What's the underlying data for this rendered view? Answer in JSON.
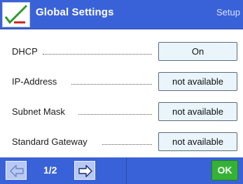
{
  "header": {
    "title": "Global Settings",
    "context": "Setup",
    "icon": "checkmark-settings-icon"
  },
  "settings": [
    {
      "label": "DHCP",
      "value": "On"
    },
    {
      "label": "IP-Address",
      "value": "not available"
    },
    {
      "label": "Subnet Mask",
      "value": "not available"
    },
    {
      "label": "Standard Gateway",
      "value": "not available"
    }
  ],
  "footer": {
    "page_indicator": "1/2",
    "prev_icon": "arrow-left-icon",
    "next_icon": "arrow-right-icon",
    "ok_label": "OK"
  },
  "colors": {
    "header_bg": "#3a62d8",
    "ok_green": "#35b235",
    "value_bg": "#e9f5fb"
  }
}
